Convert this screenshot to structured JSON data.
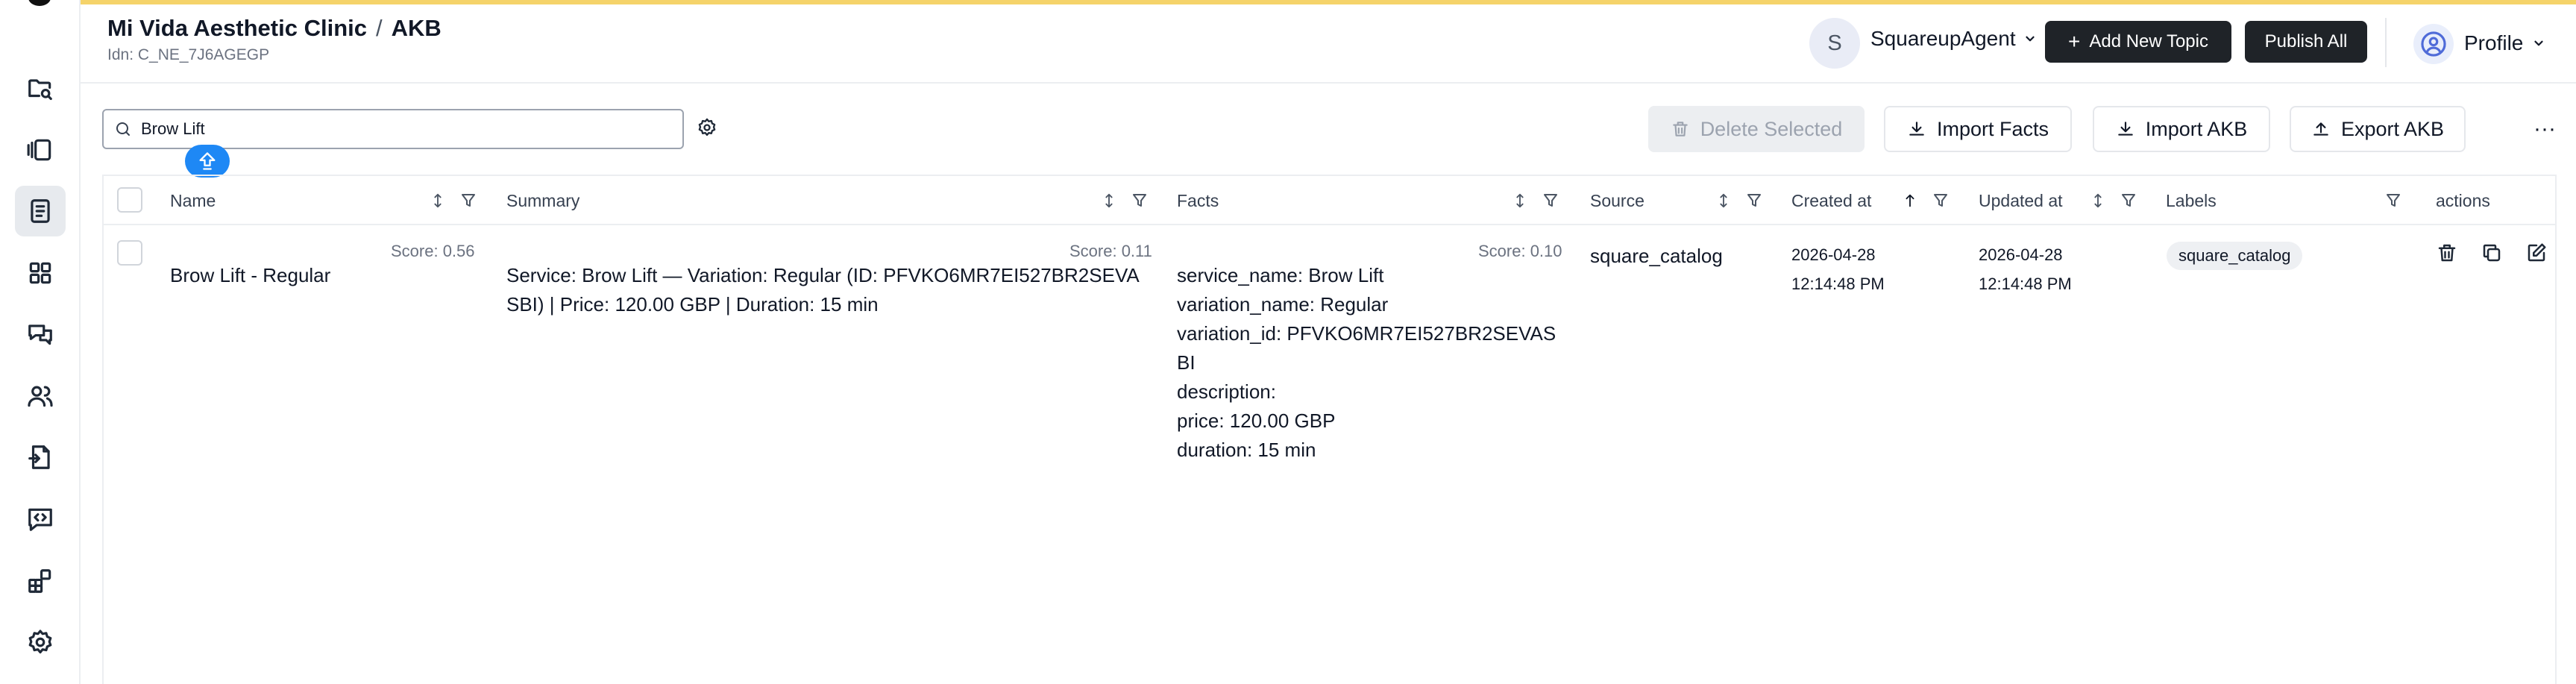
{
  "header": {
    "clinic": "Mi Vida Aesthetic Clinic",
    "separator": "/",
    "section": "AKB",
    "idn": "Idn: C_NE_7J6AGEGP",
    "agent_initial": "S",
    "agent_name": "SquareupAgent",
    "add_topic_label": "Add New Topic",
    "publish_all_label": "Publish All",
    "profile_label": "Profile"
  },
  "toolbar": {
    "search_value": "Brow Lift",
    "delete_label": "Delete Selected",
    "import_facts_label": "Import Facts",
    "import_akb_label": "Import AKB",
    "export_akb_label": "Export AKB",
    "more_label": "···"
  },
  "table": {
    "columns": {
      "name": "Name",
      "summary": "Summary",
      "facts": "Facts",
      "source": "Source",
      "created": "Created at",
      "updated": "Updated at",
      "labels": "Labels",
      "actions": "actions"
    },
    "rows": [
      {
        "name": "Brow Lift - Regular",
        "name_score": "Score: 0.56",
        "summary_score": "Score: 0.11",
        "summary_line1": "Service: Brow Lift — Variation: Regular (ID: PFVKO6MR7EI527BR2SEVA",
        "summary_line2": "SBI) | Price: 120.00 GBP | Duration: 15 min",
        "facts_score": "Score: 0.10",
        "facts_line1": "service_name: Brow Lift",
        "facts_line2": "variation_name: Regular",
        "facts_line3": "variation_id: PFVKO6MR7EI527BR2SEVAS",
        "facts_line4": "BI",
        "facts_line5": "description:",
        "facts_line6": "price: 120.00 GBP",
        "facts_line7": "duration: 15 min",
        "source": "square_catalog",
        "created_date": "2026-04-28",
        "created_time": "12:14:48 PM",
        "updated_date": "2026-04-28",
        "updated_time": "12:14:48 PM",
        "label": "square_catalog"
      }
    ]
  }
}
